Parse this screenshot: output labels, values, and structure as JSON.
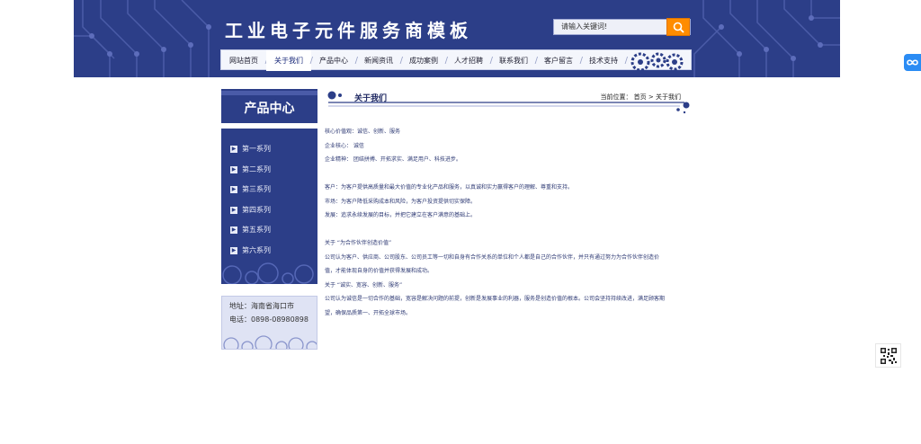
{
  "header": {
    "site_title": "工业电子元件服务商模板",
    "search_placeholder": "请输入关键词!",
    "search_icon": "search-icon",
    "colors": {
      "header_bg": "#2c3e88",
      "search_button": "#ff8c00"
    }
  },
  "nav": {
    "items": [
      {
        "label": "网站首页",
        "active": false
      },
      {
        "label": "关于我们",
        "active": true
      },
      {
        "label": "产品中心",
        "active": false
      },
      {
        "label": "新闻资讯",
        "active": false
      },
      {
        "label": "成功案例",
        "active": false
      },
      {
        "label": "人才招聘",
        "active": false
      },
      {
        "label": "联系我们",
        "active": false
      },
      {
        "label": "客户留言",
        "active": false
      },
      {
        "label": "技术支持",
        "active": false
      }
    ]
  },
  "sidebar": {
    "title": "产品中心",
    "items": [
      {
        "label": "第一系列"
      },
      {
        "label": "第二系列"
      },
      {
        "label": "第三系列"
      },
      {
        "label": "第四系列"
      },
      {
        "label": "第五系列"
      },
      {
        "label": "第六系列"
      }
    ],
    "contact": {
      "address": "地址：海南省海口市",
      "phone": "电话：0898-08980898"
    }
  },
  "main": {
    "title": "关于我们",
    "breadcrumb": "当前位置： 首页 > 关于我们",
    "paragraphs": {
      "p1": "核心价值观：诚信、创新、服务",
      "p2": "企业核心： 诚信",
      "p3": "企业精神： 团结拼搏、开拓求实、满足用户、科技进步。",
      "p4": "客户：为客户提供高质量和最大价值的专业化产品和服务，以真诚和实力赢得客户的理解、尊重和支持。",
      "p5": "市场：为客户降低采购成本和风险，为客户投资提供切实保障。",
      "p6": "发展：追求永续发展的目标，并把它建立在客户满意的基础上。",
      "p7": "关于 “为合作伙伴创造价值”",
      "p8": "公司认为客户、供应商、公司股东、公司员工等一切和自身有合作关系的单位和个人都是自己的合作伙伴，并只有通过努力为合作伙伴创造价",
      "p9": "值，才能体现自身的价值并获得发展和成功。",
      "p10": "关于 “诚实、宽容、创新、服务”",
      "p11": "公司认为诚信是一切合作的基础，宽容是解决问题的前提，创新是发展事业的利器，服务是创造价值的根本。公司会坚持持续改进，满足顾客期",
      "p12": "望，确保品质第一、开拓全球市场。"
    }
  },
  "floating": {
    "side_tab_icon": "infinity-icon",
    "qr_icon": "qr-code-icon"
  }
}
